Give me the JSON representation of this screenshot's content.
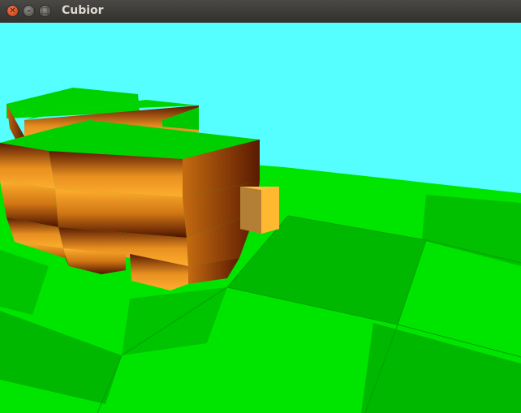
{
  "window": {
    "title": "Cubior",
    "close_glyph": "✕",
    "minimize_glyph": "–",
    "maximize_glyph": "□",
    "controls": [
      "close-icon",
      "minimize-icon",
      "maximize-icon"
    ]
  },
  "scene": {
    "sky_color": "#55ffff",
    "grass_light": "#00e500",
    "grass_dark": "#00b400",
    "cube_top": "#00d000",
    "cube_side_light": "#f0a020",
    "cube_side_dark": "#5a1800",
    "player_color": "#ffc040"
  }
}
